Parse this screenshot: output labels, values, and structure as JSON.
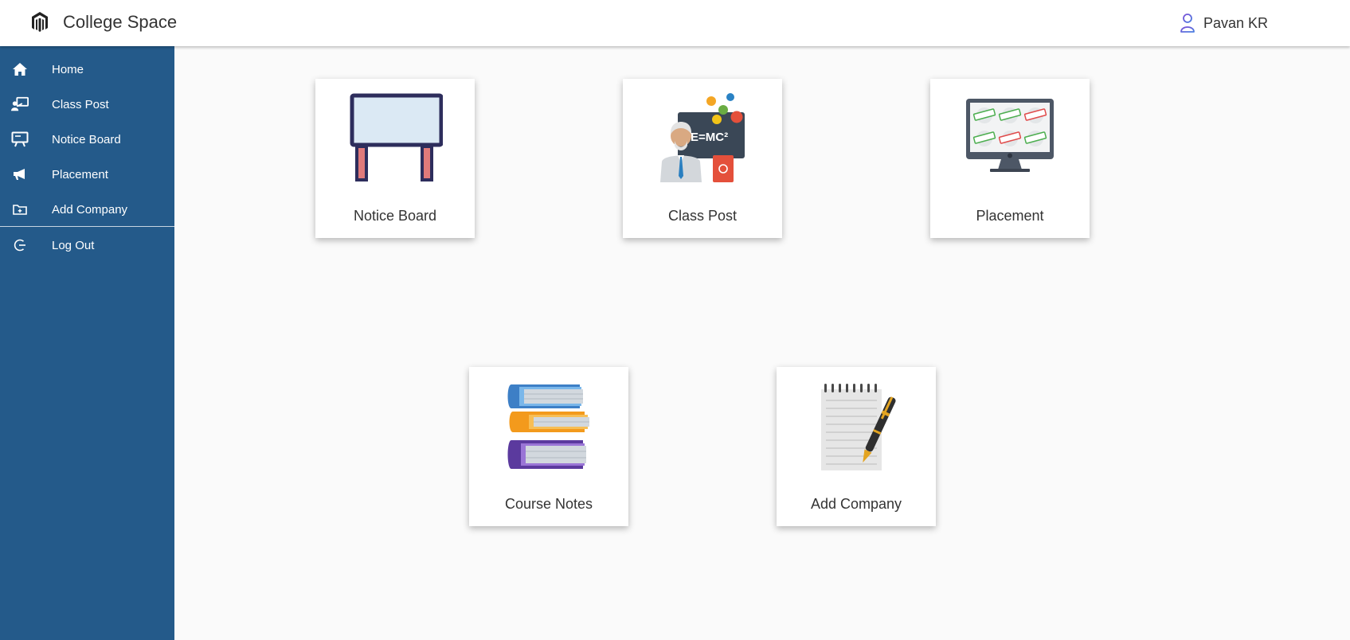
{
  "header": {
    "app_title": "College Space",
    "logo_icon": "magento-logo-icon",
    "user_icon": "person-outline-icon",
    "user_name": "Pavan KR"
  },
  "sidebar": {
    "background_color": "#245a8a",
    "items": [
      {
        "label": "Home",
        "icon": "home-icon"
      },
      {
        "label": "Class Post",
        "icon": "teacher-board-icon"
      },
      {
        "label": "Notice Board",
        "icon": "presentation-screen-icon"
      },
      {
        "label": "Placement",
        "icon": "megaphone-icon"
      },
      {
        "label": "Add Company",
        "icon": "folder-plus-icon"
      },
      {
        "label": "Log Out",
        "icon": "logout-icon"
      }
    ]
  },
  "cards": [
    {
      "label": "Notice Board",
      "icon": "notice-board-illustration"
    },
    {
      "label": "Class Post",
      "icon": "teacher-formula-illustration"
    },
    {
      "label": "Placement",
      "icon": "monitor-grid-illustration"
    },
    {
      "label": "Course Notes",
      "icon": "book-stack-illustration"
    },
    {
      "label": "Add Company",
      "icon": "notepad-pen-illustration"
    }
  ],
  "formula_text": "E=MC²"
}
